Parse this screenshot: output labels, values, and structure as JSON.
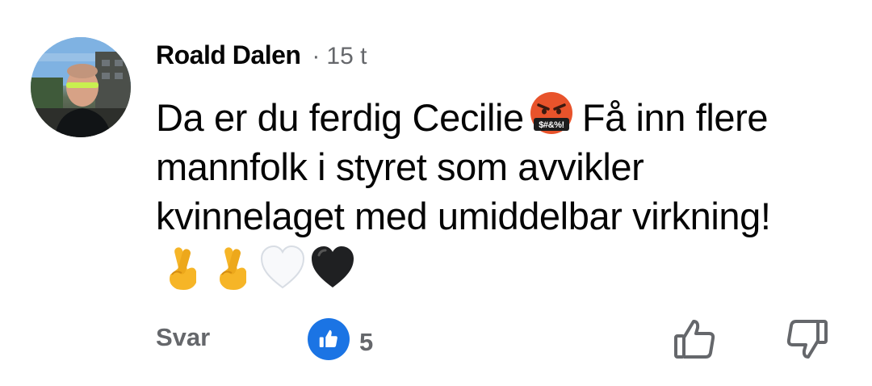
{
  "comment": {
    "author": "Roald Dalen",
    "separator": "·",
    "time": "15 t",
    "text_lines": [
      {
        "before": "Da er du ferdig Cecilie",
        "emoji": "face-with-symbols-on-mouth",
        "after": "Få inn flere"
      },
      {
        "text": "mannfolk i styret som avvikler"
      },
      {
        "text": "kvinnelaget med umiddelbar virkning!"
      }
    ],
    "emoji_row": [
      "crossed-fingers",
      "crossed-fingers",
      "white-heart",
      "black-heart"
    ],
    "symbols_text": "$#&%!"
  },
  "actions": {
    "reply_label": "Svar",
    "like_count": "5"
  },
  "colors": {
    "text": "#050505",
    "muted": "#65676b",
    "like_blue": "#1b74e4"
  }
}
